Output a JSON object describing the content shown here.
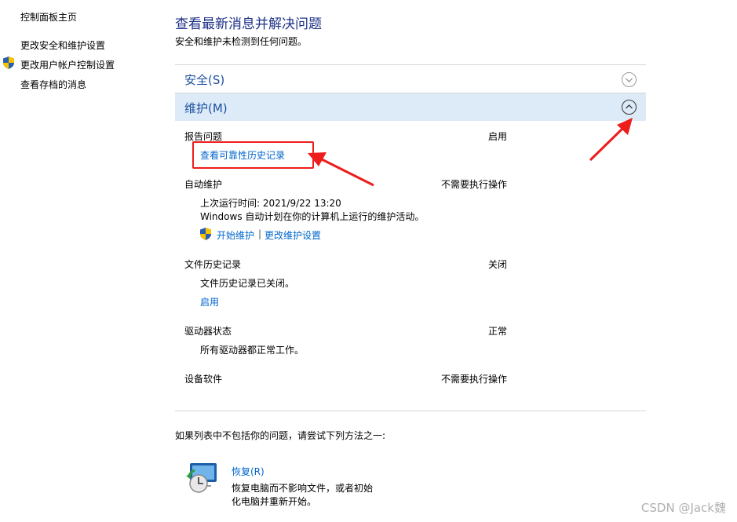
{
  "nav": {
    "home": "控制面板主页",
    "items": [
      "更改安全和维护设置",
      "更改用户帐户控制设置",
      "查看存档的消息"
    ]
  },
  "header": {
    "title": "查看最新消息并解决问题",
    "subtitle": "安全和维护未检测到任何问题。"
  },
  "security": {
    "label": "安全(S)"
  },
  "maintenance": {
    "label": "维护(M)",
    "report": {
      "label": "报告问题",
      "status": "启用",
      "link": "查看可靠性历史记录"
    },
    "auto": {
      "label": "自动维护",
      "status": "不需要执行操作",
      "last_run": "上次运行时间: 2021/9/22 13:20",
      "desc": "Windows 自动计划在你的计算机上运行的维护活动。",
      "start_link": "开始维护",
      "separator": "|",
      "change_link": "更改维护设置"
    },
    "file_history": {
      "label": "文件历史记录",
      "status": "关闭",
      "desc": "文件历史记录已关闭。",
      "link": "启用"
    },
    "drive": {
      "label": "驱动器状态",
      "status": "正常",
      "desc": "所有驱动器都正常工作。"
    },
    "device": {
      "label": "设备软件",
      "status": "不需要执行操作"
    }
  },
  "footer": {
    "prompt": "如果列表中不包括你的问题，请尝试下列方法之一:",
    "recovery": {
      "link": "恢复(R)",
      "desc_line1": "恢复电脑而不影响文件，或者初始",
      "desc_line2": "化电脑并重新开始。"
    }
  },
  "watermark": "CSDN @Jack魏",
  "colors": {
    "title": "#1e3287",
    "link": "#0066cc",
    "section_highlight": "#dcebf7",
    "annotation_red": "#ef1c1c"
  }
}
